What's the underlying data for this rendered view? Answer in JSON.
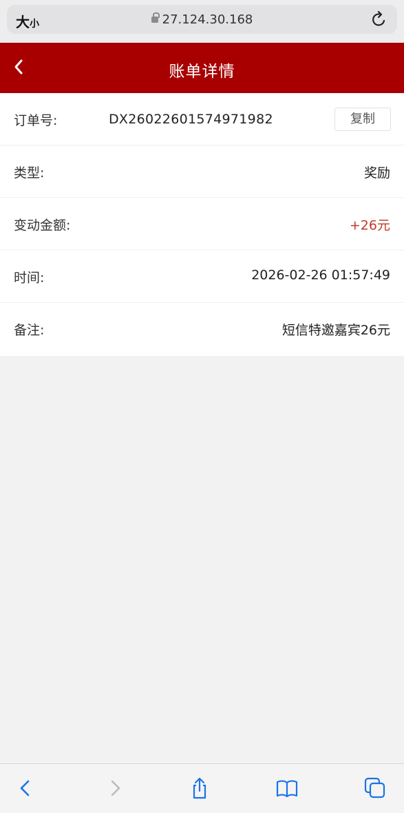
{
  "browser": {
    "text_size_big": "大",
    "text_size_small": "小",
    "url": "27.124.30.168"
  },
  "header": {
    "title": "账单详情"
  },
  "details": {
    "order": {
      "label": "订单号:",
      "value": "DX26022601574971982",
      "copy_label": "复制"
    },
    "type": {
      "label": "类型:",
      "value": "奖励"
    },
    "amount": {
      "label": "变动金额:",
      "value": "+26元"
    },
    "time": {
      "label": "时间:",
      "value": "2026-02-26 01:57:49"
    },
    "note": {
      "label": "备注:",
      "value": "短信特邀嘉宾26元"
    }
  },
  "colors": {
    "header_bg": "#a80000",
    "amount_text": "#c0392b",
    "toolbar_icon": "#1a73e8"
  },
  "toolbar": {
    "icons": [
      "back-icon",
      "forward-icon",
      "share-icon",
      "bookmarks-icon",
      "tabs-icon"
    ]
  }
}
